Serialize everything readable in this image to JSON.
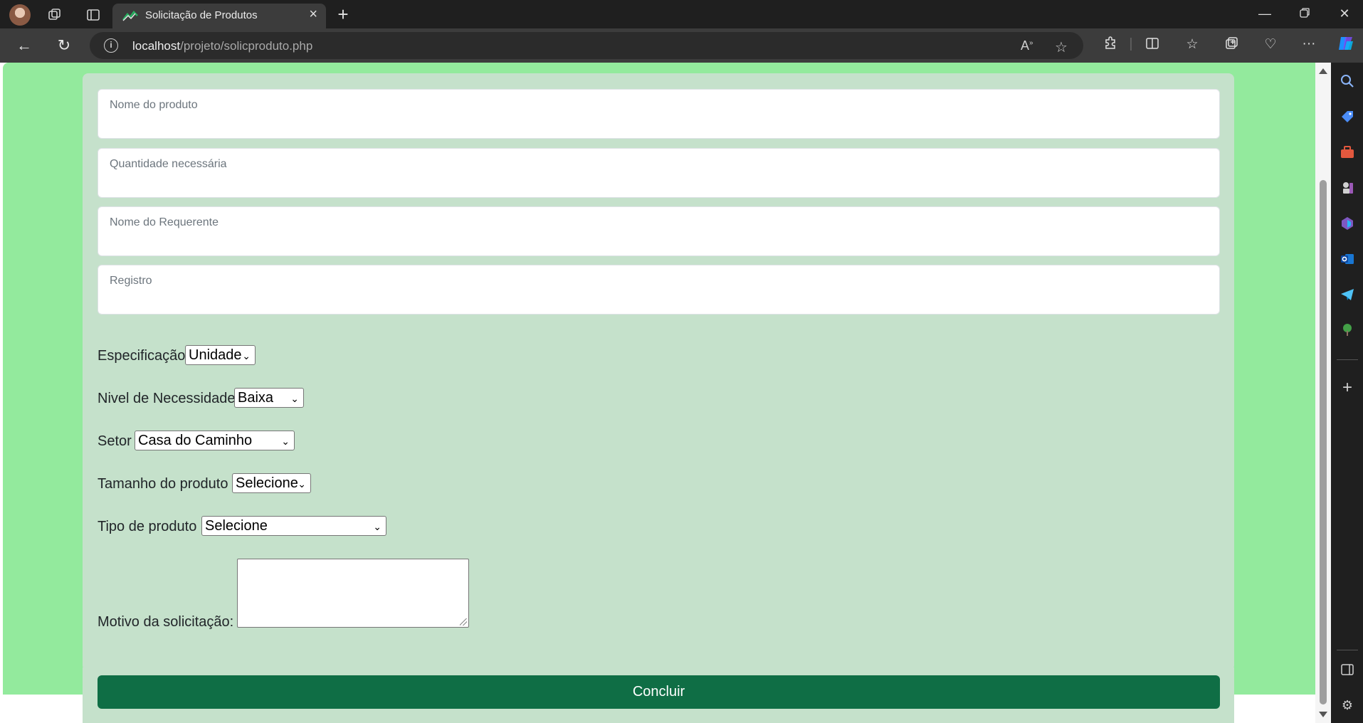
{
  "browser": {
    "tab_title": "Solicitação de Produtos",
    "url_host": "localhost",
    "url_path": "/projeto/solicproduto.php",
    "accent": "#0f6e45"
  },
  "form": {
    "fields": [
      {
        "label": "Nome do produto",
        "value": ""
      },
      {
        "label": "Quantidade necessária",
        "value": ""
      },
      {
        "label": "Nome do Requerente",
        "value": ""
      },
      {
        "label": "Registro",
        "value": ""
      }
    ],
    "especificacao": {
      "label": "Especificação",
      "selected": "Unidade"
    },
    "nivel": {
      "label": "Nivel de Necessidade",
      "selected": "Baixa"
    },
    "setor": {
      "label": "Setor",
      "selected": "Casa do Caminho"
    },
    "tamanho": {
      "label": "Tamanho do produto",
      "selected": "Selecione"
    },
    "tipo": {
      "label": "Tipo de produto",
      "selected": "Selecione"
    },
    "motivo": {
      "label": "Motivo da solicitação:",
      "value": ""
    },
    "submit_label": "Concluir"
  },
  "colors": {
    "page_background": "#93ea9d",
    "card_background": "#c5e1cb",
    "button_background": "#0f6e45"
  }
}
